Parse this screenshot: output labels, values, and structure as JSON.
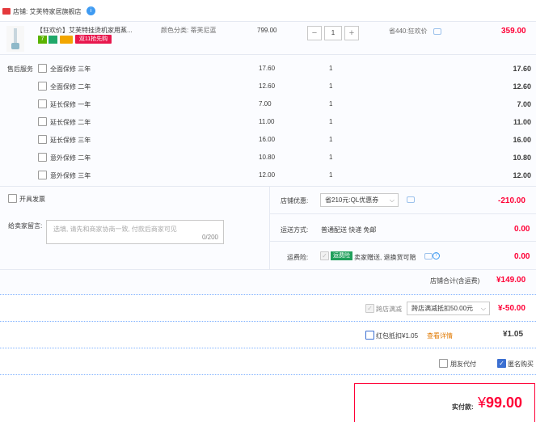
{
  "shop": {
    "label": "店铺: 艾芙特家居旗舰店",
    "ww_icon": "i"
  },
  "product": {
    "title": "【狂欢价】艾芙特挂烫机家用蒸...",
    "attr": "颜色分类: 蒂芙尼蓝",
    "badge_7": "7",
    "badge_d11": "双11抢先购",
    "unit_price": "799.00",
    "qty": "1",
    "saving": "省440:狂欢价",
    "subtotal": "359.00"
  },
  "services": {
    "label": "售后服务",
    "items": [
      {
        "name": "全面保修  三年",
        "price": "17.60",
        "qty": "1",
        "total": "17.60"
      },
      {
        "name": "全面保修  二年",
        "price": "12.60",
        "qty": "1",
        "total": "12.60"
      },
      {
        "name": "延长保修  一年",
        "price": "7.00",
        "qty": "1",
        "total": "7.00"
      },
      {
        "name": "延长保修  二年",
        "price": "11.00",
        "qty": "1",
        "total": "11.00"
      },
      {
        "name": "延长保修  三年",
        "price": "16.00",
        "qty": "1",
        "total": "16.00"
      },
      {
        "name": "意外保修  二年",
        "price": "10.80",
        "qty": "1",
        "total": "10.80"
      },
      {
        "name": "意外保修  三年",
        "price": "12.00",
        "qty": "1",
        "total": "12.00"
      }
    ]
  },
  "invoice": {
    "label": "开具发票"
  },
  "message": {
    "label": "给卖家留言:",
    "placeholder": "选填, 请先和商家协商一致, 付款后商家可见",
    "count": "0/200"
  },
  "coupon": {
    "label": "店铺优惠:",
    "selected": "省210元:QL优惠券",
    "amount": "-210.00"
  },
  "shipping": {
    "label": "运送方式:",
    "value": "普通配送 快递 免邮",
    "amount": "0.00"
  },
  "insurance": {
    "label": "运费险:",
    "badge": "运费险",
    "text": "卖家赠送, 退换货可赔",
    "amount": "0.00"
  },
  "shop_total": {
    "label": "店铺合计(含运费)",
    "amount": "¥149.00"
  },
  "promo": {
    "label": "跨店满减",
    "selected": "跨店满减抵扣50.00元",
    "amount": "¥-50.00"
  },
  "red_packet": {
    "label": "红包抵扣¥1.05",
    "link": "查看详情",
    "amount": "¥1.05"
  },
  "options": {
    "friend_pay": "朋友代付",
    "anonymous": "匿名购买"
  },
  "payment": {
    "label": "实付款:",
    "currency": "¥",
    "amount": "99.00"
  },
  "colors": {
    "accent_red": "#ff0036",
    "link_blue": "#3b6fd1",
    "border": "#e5e9f2"
  }
}
